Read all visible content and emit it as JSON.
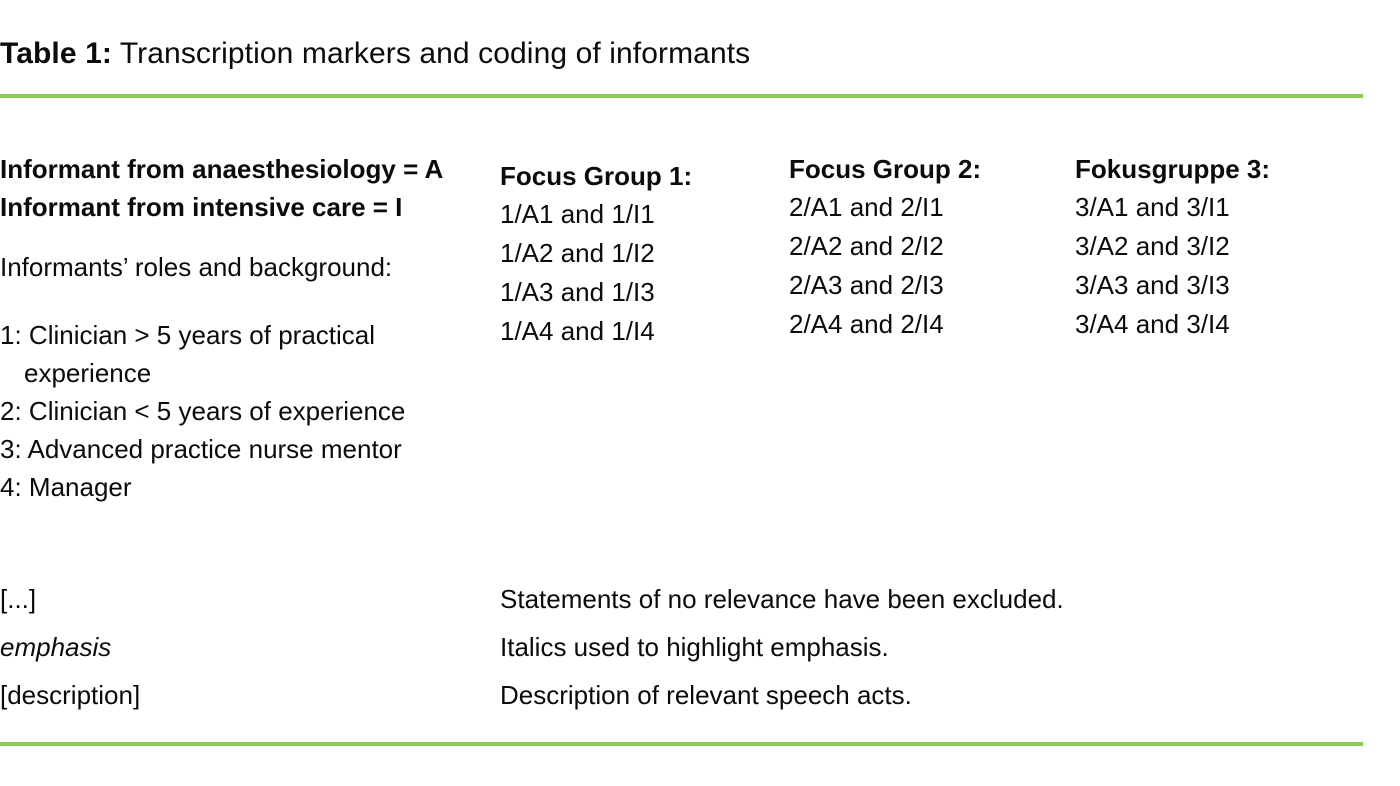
{
  "caption": {
    "label": "Table 1:",
    "text": "Transcription markers and coding of informants"
  },
  "colors": {
    "rule_green": "#8DCD55",
    "text": "#0B0B0B",
    "background": "#FFFFFF"
  },
  "legend": {
    "code_lines": [
      "Informant from anaesthesiology = A",
      "Informant from intensive care = I"
    ],
    "roles_heading": "Informants’ roles and background:",
    "roles": [
      {
        "number": "1",
        "text": ": Clinician > 5 years of practical",
        "continuation": "experience"
      },
      {
        "number": "2",
        "text": ": Clinician < 5 years of experience",
        "continuation": ""
      },
      {
        "number": "3",
        "text": ": Advanced practice nurse mentor",
        "continuation": ""
      },
      {
        "number": "4",
        "text": ": Manager",
        "continuation": ""
      }
    ]
  },
  "groups": [
    {
      "heading": "Focus Group 1:",
      "items": [
        "1/A1 and 1/I1",
        "1/A2 and 1/I2",
        "1/A3 and 1/I3",
        "1/A4 and 1/I4"
      ]
    },
    {
      "heading": "Focus Group 2:",
      "items": [
        "2/A1 and 2/I1",
        "2/A2 and 2/I2",
        "2/A3 and 2/I3",
        "2/A4 and 2/I4"
      ]
    },
    {
      "heading": "Fokusgruppe 3:",
      "items": [
        "3/A1 and 3/I1",
        "3/A2 and 3/I2",
        "3/A3 and 3/I3",
        "3/A4 and 3/I4"
      ]
    }
  ],
  "markers": [
    {
      "key": "[...]",
      "description": "Statements of no relevance have been excluded.",
      "style": "normal"
    },
    {
      "key": "emphasis",
      "description": "Italics used to highlight emphasis.",
      "style": "italic"
    },
    {
      "key": "[description]",
      "description": "Description of relevant speech acts.",
      "style": "normal"
    }
  ]
}
